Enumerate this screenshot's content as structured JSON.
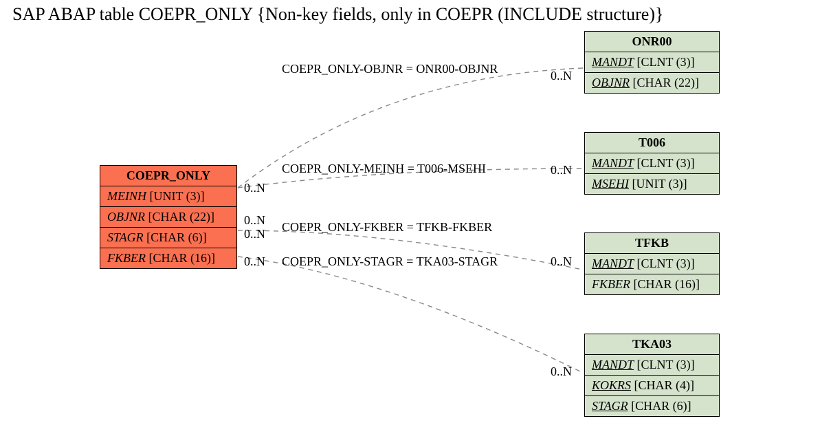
{
  "title": "SAP ABAP table COEPR_ONLY {Non-key fields, only in COEPR (INCLUDE structure)}",
  "main": {
    "name": "COEPR_ONLY",
    "fields": [
      {
        "name": "MEINH",
        "type": "[UNIT (3)]"
      },
      {
        "name": "OBJNR",
        "type": "[CHAR (22)]"
      },
      {
        "name": "STAGR",
        "type": "[CHAR (6)]"
      },
      {
        "name": "FKBER",
        "type": "[CHAR (16)]"
      }
    ]
  },
  "refs": {
    "onr00": {
      "name": "ONR00",
      "fields": [
        {
          "name": "MANDT",
          "type": "[CLNT (3)]",
          "ul": true
        },
        {
          "name": "OBJNR",
          "type": "[CHAR (22)]",
          "ul": true
        }
      ]
    },
    "t006": {
      "name": "T006",
      "fields": [
        {
          "name": "MANDT",
          "type": "[CLNT (3)]",
          "ul": true
        },
        {
          "name": "MSEHI",
          "type": "[UNIT (3)]",
          "ul": true
        }
      ]
    },
    "tfkb": {
      "name": "TFKB",
      "fields": [
        {
          "name": "MANDT",
          "type": "[CLNT (3)]",
          "ul": true
        },
        {
          "name": "FKBER",
          "type": "[CHAR (16)]"
        }
      ]
    },
    "tka03": {
      "name": "TKA03",
      "fields": [
        {
          "name": "MANDT",
          "type": "[CLNT (3)]",
          "ul": true
        },
        {
          "name": "KOKRS",
          "type": "[CHAR (4)]",
          "ul": true
        },
        {
          "name": "STAGR",
          "type": "[CHAR (6)]",
          "ul": true
        }
      ]
    }
  },
  "rels": {
    "r1": "COEPR_ONLY-OBJNR = ONR00-OBJNR",
    "r2": "COEPR_ONLY-MEINH = T006-MSEHI",
    "r3": "COEPR_ONLY-FKBER = TFKB-FKBER",
    "r4": "COEPR_ONLY-STAGR = TKA03-STAGR"
  },
  "card": {
    "c1l": "0..N",
    "c1r": "0..N",
    "c2r": "0..N",
    "c3l": "0..N",
    "c3r2": "0..N",
    "c4l": "0..N",
    "c4r": "0..N",
    "c3r": "0..N"
  }
}
